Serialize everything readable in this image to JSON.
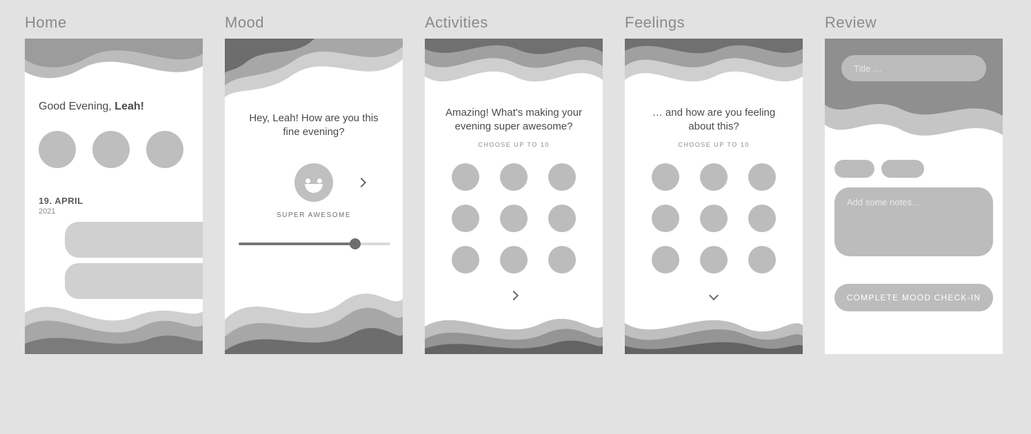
{
  "frames": {
    "home": {
      "title": "Home"
    },
    "mood": {
      "title": "Mood"
    },
    "activities": {
      "title": "Activities"
    },
    "feelings": {
      "title": "Feelings"
    },
    "review": {
      "title": "Review"
    }
  },
  "home": {
    "greeting_prefix": "Good Evening, ",
    "greeting_name": "Leah!",
    "date_day": "19. APRIL",
    "date_year": "2021"
  },
  "mood": {
    "question": "Hey, Leah! How are you this fine evening?",
    "mood_label": "SUPER AWESOME"
  },
  "activities": {
    "question": "Amazing! What's making your evening super awesome?",
    "sub_note": "CHOOSE UP TO 10"
  },
  "feelings": {
    "question": "… and how are you feeling about this?",
    "sub_note": "CHOOSE UP TO 10"
  },
  "review": {
    "title_placeholder": "Title …",
    "notes_placeholder": "Add some notes…",
    "complete_label": "COMPLETE MOOD CHECK-IN"
  }
}
